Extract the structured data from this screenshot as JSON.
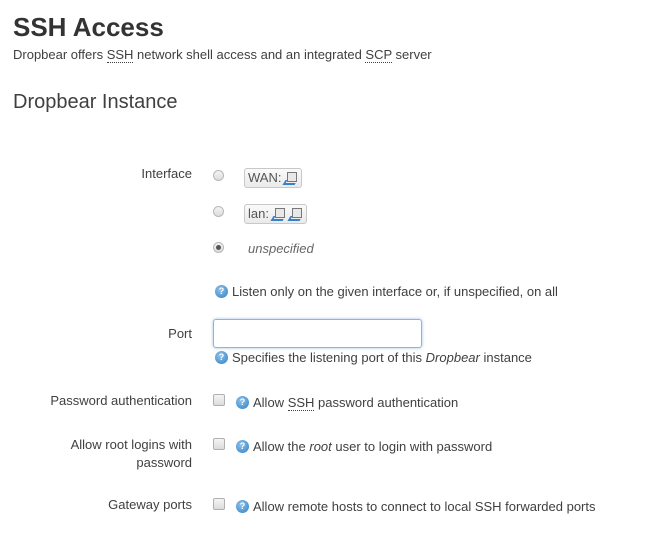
{
  "page": {
    "title": "SSH Access",
    "description_parts": [
      "Dropbear offers ",
      "SSH",
      " network shell access and an integrated ",
      "SCP",
      " server"
    ]
  },
  "section": {
    "title": "Dropbear Instance"
  },
  "interface": {
    "label": "Interface",
    "options": [
      {
        "label": "WAN:",
        "icons": 1,
        "selected": false
      },
      {
        "label": "lan:",
        "icons": 2,
        "selected": false
      },
      {
        "label": "unspecified",
        "selected": true
      }
    ],
    "help": "Listen only on the given interface or, if unspecified, on all"
  },
  "port": {
    "label": "Port",
    "value": "",
    "help_parts": [
      "Specifies the listening port of this ",
      "Dropbear",
      " instance"
    ]
  },
  "password_auth": {
    "label": "Password authentication",
    "checked": false,
    "help_parts": [
      "Allow ",
      "SSH",
      " password authentication"
    ]
  },
  "root_login": {
    "label_line1": "Allow root logins with",
    "label_line2": "password",
    "checked": false,
    "help_parts": [
      "Allow the ",
      "root",
      " user to login with password"
    ]
  },
  "gateway_ports": {
    "label": "Gateway ports",
    "checked": false,
    "help": "Allow remote hosts to connect to local SSH forwarded ports"
  },
  "colors": {
    "help_icon": "#2f7fc2",
    "input_focus_border": "#8bb5e0",
    "text": "#404040"
  }
}
